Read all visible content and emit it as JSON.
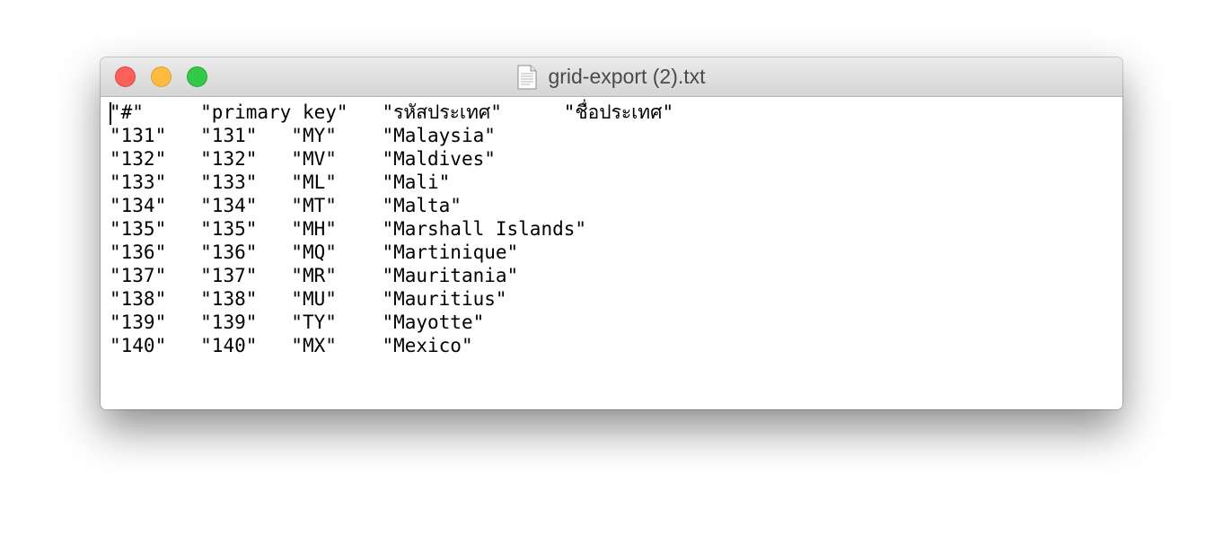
{
  "window": {
    "title": "grid-export (2).txt",
    "icons": {
      "close": "close-button",
      "minimize": "minimize-button",
      "zoom": "zoom-button",
      "document": "document-icon"
    },
    "colors": {
      "close": "#fc605c",
      "minimize": "#fdbc40",
      "zoom": "#34c84a"
    }
  },
  "document": {
    "lines": [
      "\"#\"\t\"primary key\"\t\"รหัสประเทศ\"\t\"ชื่อประเทศ\"",
      "\"131\"\t\"131\"\t\"MY\"\t\"Malaysia\"",
      "\"132\"\t\"132\"\t\"MV\"\t\"Maldives\"",
      "\"133\"\t\"133\"\t\"ML\"\t\"Mali\"",
      "\"134\"\t\"134\"\t\"MT\"\t\"Malta\"",
      "\"135\"\t\"135\"\t\"MH\"\t\"Marshall Islands\"",
      "\"136\"\t\"136\"\t\"MQ\"\t\"Martinique\"",
      "\"137\"\t\"137\"\t\"MR\"\t\"Mauritania\"",
      "\"138\"\t\"138\"\t\"MU\"\t\"Mauritius\"",
      "\"139\"\t\"139\"\t\"TY\"\t\"Mayotte\"",
      "\"140\"\t\"140\"\t\"MX\"\t\"Mexico\""
    ]
  }
}
